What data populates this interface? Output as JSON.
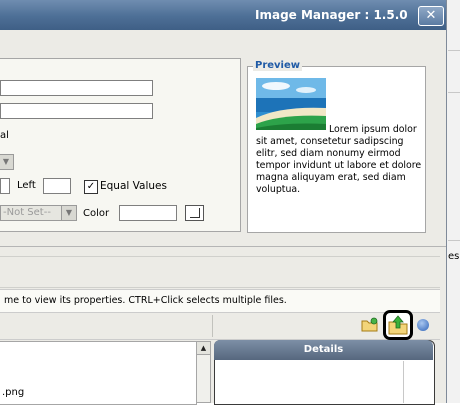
{
  "window": {
    "title": "Image Manager : 1.5.0",
    "close_label": "✕"
  },
  "properties": {
    "align_label": "al",
    "left_label": "Left",
    "equal_values_label": "Equal Values",
    "equal_values_checked": true,
    "border_select_value": "-Not Set--",
    "color_label": "Color"
  },
  "preview": {
    "legend": "Preview",
    "sample_text": "Lorem ipsum dolor sit amet, consetetur sadipscing elitr, sed diam nonumy eirmod tempor invidunt ut labore et dolore magna aliquyam erat, sed diam voluptua."
  },
  "status": {
    "hint": "me to view its properties. CTRL+Click selects multiple files."
  },
  "toolbar": {
    "icons": [
      "new-folder-icon",
      "upload-icon",
      "help-icon"
    ]
  },
  "file_list": {
    "items": [
      ".png"
    ]
  },
  "details": {
    "header": "Details"
  },
  "background": {
    "fragment": "es"
  },
  "colors": {
    "titlebar": "#4d6f96",
    "preview_legend": "#1f5aa6",
    "details_header": "#56677e"
  }
}
